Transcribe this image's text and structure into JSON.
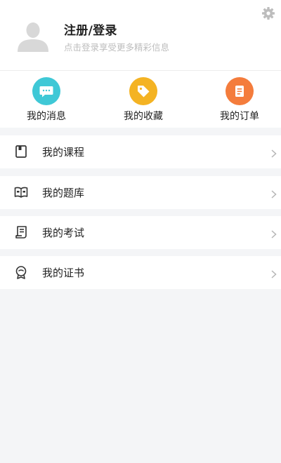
{
  "header": {
    "title": "注册/登录",
    "subtitle": "点击登录享受更多精彩信息",
    "avatar_icon": "default-avatar-icon",
    "settings_icon": "gear-icon"
  },
  "quick_actions": [
    {
      "label": "我的消息",
      "icon": "message-icon",
      "color": "#3fc8d6"
    },
    {
      "label": "我的收藏",
      "icon": "tag-icon",
      "color": "#f4b323"
    },
    {
      "label": "我的订单",
      "icon": "order-icon",
      "color": "#f47c3c"
    }
  ],
  "menu": [
    {
      "label": "我的课程",
      "icon": "course-icon"
    },
    {
      "label": "我的题库",
      "icon": "question-bank-icon"
    },
    {
      "label": "我的考试",
      "icon": "exam-icon"
    },
    {
      "label": "我的证书",
      "icon": "certificate-icon"
    }
  ],
  "colors": {
    "background": "#f4f5f7",
    "card": "#ffffff",
    "text": "#222222",
    "subtitle": "#bdbdbd",
    "arrow": "#b5b5b5"
  }
}
